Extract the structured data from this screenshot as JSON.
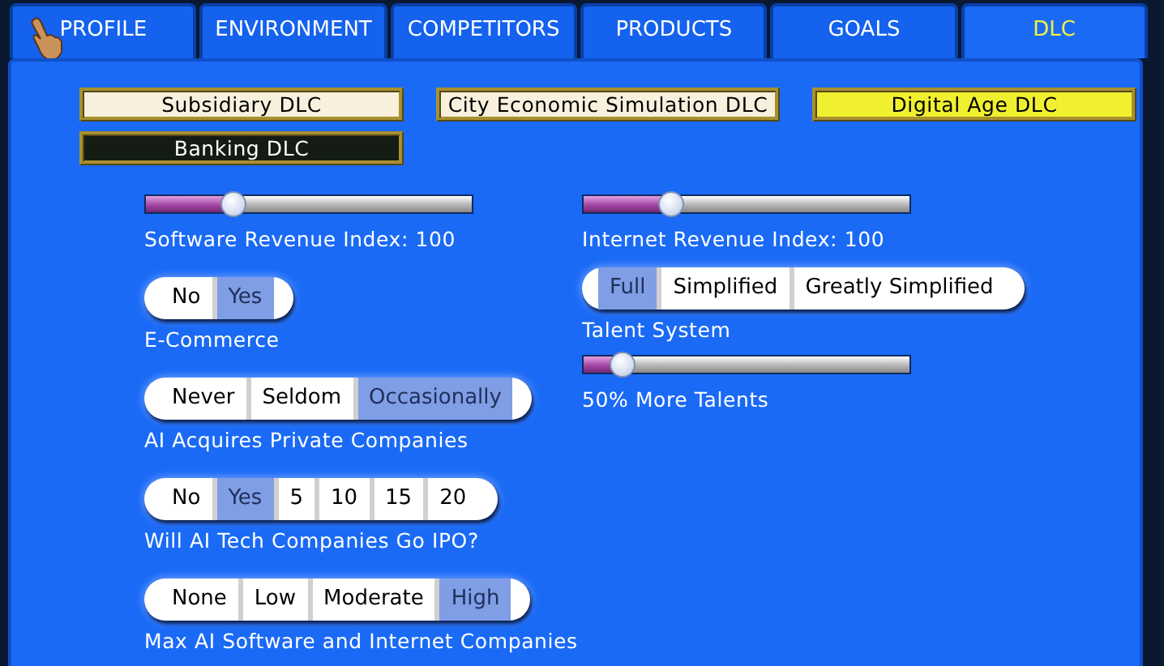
{
  "tabs": [
    {
      "label": "PROFILE",
      "selected": false
    },
    {
      "label": "ENVIRONMENT",
      "selected": false
    },
    {
      "label": "COMPETITORS",
      "selected": false
    },
    {
      "label": "PRODUCTS",
      "selected": false
    },
    {
      "label": "GOALS",
      "selected": false
    },
    {
      "label": "DLC",
      "selected": true
    }
  ],
  "dlc_buttons": [
    {
      "label": "Subsidiary DLC",
      "color": "#f8f0dc"
    },
    {
      "label": "City Economic Simulation DLC",
      "color": "#f8f0dc"
    },
    {
      "label": "Digital Age DLC",
      "color": "#f0f030"
    },
    {
      "label": "Banking DLC",
      "color": "#141c14"
    }
  ],
  "left_settings": [
    {
      "kind": "slider",
      "level": 0.27,
      "label": "Software Revenue Index:  100"
    },
    {
      "kind": "options",
      "label": "E-Commerce",
      "options": [
        {
          "label": "No",
          "selected": false
        },
        {
          "label": "Yes",
          "selected": true
        }
      ]
    },
    {
      "kind": "options",
      "label": "AI Acquires Private Companies",
      "options": [
        {
          "label": "Never",
          "selected": false
        },
        {
          "label": "Seldom",
          "selected": false
        },
        {
          "label": "Occasionally",
          "selected": true
        }
      ]
    },
    {
      "kind": "options",
      "label": "Will AI Tech Companies Go IPO?",
      "options": [
        {
          "label": "No",
          "selected": false
        },
        {
          "label": "Yes",
          "selected": true
        },
        {
          "label": "5",
          "selected": false
        },
        {
          "label": "10",
          "selected": false
        },
        {
          "label": "15",
          "selected": false
        },
        {
          "label": "20",
          "selected": false
        }
      ]
    },
    {
      "kind": "options",
      "label": "Max AI Software and Internet Companies",
      "options": [
        {
          "label": "None",
          "selected": false
        },
        {
          "label": "Low",
          "selected": false
        },
        {
          "label": "Moderate",
          "selected": false
        },
        {
          "label": "High",
          "selected": true
        }
      ]
    }
  ],
  "right_settings": [
    {
      "kind": "slider",
      "level": 0.27,
      "label": "Internet Revenue Index:  100"
    },
    {
      "kind": "options",
      "label": "Talent System",
      "options": [
        {
          "label": "Full",
          "selected": true
        },
        {
          "label": "Simplified",
          "selected": false
        },
        {
          "label": "Greatly Simplified",
          "selected": false
        }
      ]
    },
    {
      "kind": "slider",
      "level": 0.12,
      "label": "50%  More Talents"
    }
  ]
}
